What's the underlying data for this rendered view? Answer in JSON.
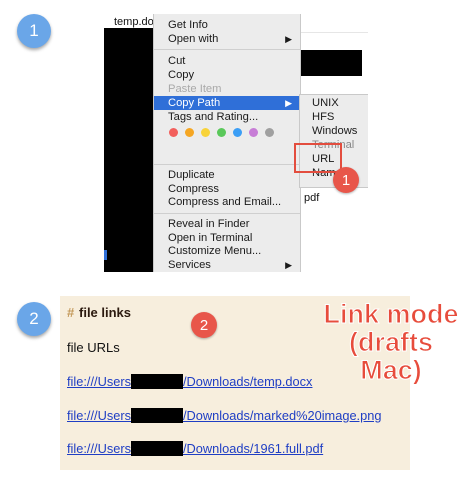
{
  "steps": {
    "one": "1",
    "two": "2"
  },
  "finder": {
    "filename": "temp.docx",
    "partial_right": "pdf",
    "menu": {
      "get_info": "Get Info",
      "open_with": "Open with",
      "cut": "Cut",
      "copy": "Copy",
      "paste_item": "Paste Item",
      "copy_path": "Copy Path",
      "tags": "Tags and Rating...",
      "duplicate": "Duplicate",
      "compress": "Compress",
      "compress_email": "Compress and Email...",
      "reveal": "Reveal in Finder",
      "open_terminal": "Open in Terminal",
      "customize": "Customize Menu...",
      "services": "Services",
      "arrow": "▶"
    },
    "tag_colors": [
      "#f25f5c",
      "#f5a623",
      "#f8d33a",
      "#5ac85a",
      "#3b9ef5",
      "#c77dd6",
      "#a0a0a0"
    ],
    "submenu": {
      "unix": "UNIX",
      "hfs": "HFS",
      "windows": "Windows",
      "terminal": "Terminal",
      "url": "URL",
      "name": "Name"
    },
    "badge": "1"
  },
  "drafts": {
    "hash": "#",
    "heading": "file links",
    "subheading": "file URLs",
    "badge": "2",
    "overlay_line1": "Link mode",
    "overlay_line2": "(drafts Mac)",
    "links": [
      {
        "prefix": "file:///Users",
        "suffix": "/Downloads/temp.docx"
      },
      {
        "prefix": "file:///Users",
        "suffix": "/Downloads/marked%20image.png"
      },
      {
        "prefix": "file:///Users",
        "suffix": "/Downloads/1961.full.pdf"
      }
    ]
  }
}
